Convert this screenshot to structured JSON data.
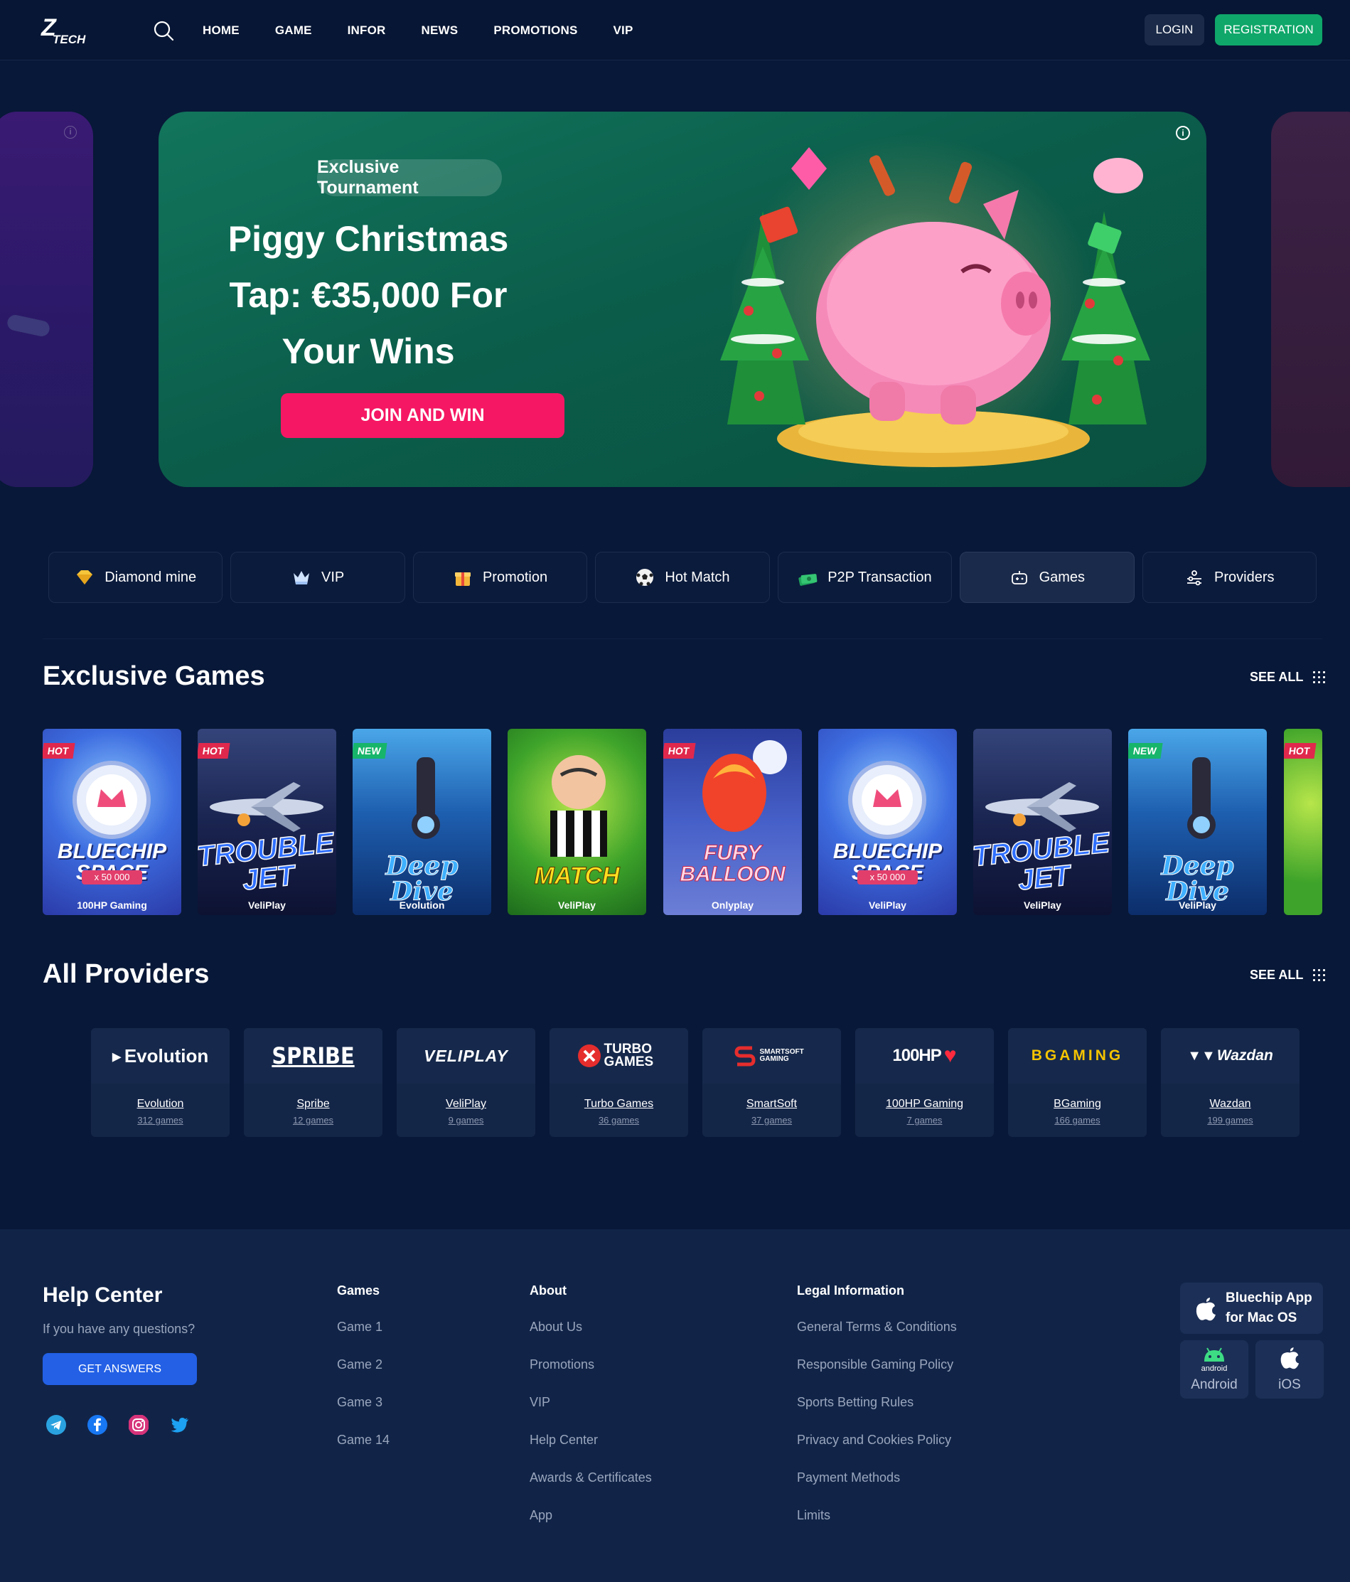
{
  "header": {
    "logo_mark": "Z",
    "logo_text": "TECH",
    "nav": [
      "HOME",
      "GAME",
      "INFOR",
      "NEWS",
      "PROMOTIONS",
      "VIP"
    ],
    "login_label": "LOGIN",
    "registration_label": "REGISTRATION"
  },
  "banner": {
    "badge": "Exclusive Tournament",
    "title": "Piggy Christmas Tap: €35,000 For Your Wins",
    "cta": "JOIN AND WIN",
    "info_glyph": "i"
  },
  "quick_links": [
    {
      "label": "Diamond mine",
      "icon": "diamond-icon"
    },
    {
      "label": "VIP",
      "icon": "crown-icon"
    },
    {
      "label": "Promotion",
      "icon": "gift-icon"
    },
    {
      "label": "Hot Match",
      "icon": "soccer-ball-icon"
    },
    {
      "label": "P2P Transaction",
      "icon": "money-icon"
    },
    {
      "label": "Games",
      "icon": "gamepad-icon",
      "selected": true
    },
    {
      "label": "Providers",
      "icon": "providers-icon"
    }
  ],
  "exclusive_games": {
    "title": "Exclusive Games",
    "see_all": "SEE ALL",
    "items": [
      {
        "name": "BLUECHIP SPACE",
        "sub": "x 50 000",
        "provider": "100HP Gaming",
        "tag": "HOT"
      },
      {
        "name": "TROUBLE JET",
        "provider": "VeliPlay",
        "tag": "HOT"
      },
      {
        "name": "Deep Dive",
        "provider": "Evolution",
        "tag": "NEW"
      },
      {
        "name": "MATCH",
        "provider": "VeliPlay",
        "tag": ""
      },
      {
        "name": "FURY BALLOON",
        "provider": "Onlyplay",
        "tag": "HOT"
      },
      {
        "name": "BLUECHIP SPACE",
        "sub": "x 50 000",
        "provider": "VeliPlay",
        "tag": ""
      },
      {
        "name": "TROUBLE JET",
        "provider": "VeliPlay",
        "tag": ""
      },
      {
        "name": "Deep Dive",
        "provider": "VeliPlay",
        "tag": "NEW"
      },
      {
        "name": "",
        "provider": "",
        "tag": "HOT"
      }
    ]
  },
  "all_providers": {
    "title": "All Providers",
    "see_all": "SEE ALL",
    "items": [
      {
        "logo": "Evolution",
        "name": "Evolution",
        "count": "312 games"
      },
      {
        "logo": "SPRIBE",
        "name": "Spribe",
        "count": "12 games"
      },
      {
        "logo": "VELIPLAY",
        "name": "VeliPlay",
        "count": "9 games"
      },
      {
        "logo": "TURBO GAMES",
        "name": "Turbo Games",
        "count": "36 games"
      },
      {
        "logo": "SMARTSOFT GAMING",
        "name": "SmartSoft",
        "count": "37 games"
      },
      {
        "logo": "100HP",
        "name": "100HP Gaming",
        "count": "7 games"
      },
      {
        "logo": "BGAMING",
        "name": "BGaming",
        "count": "166 games"
      },
      {
        "logo": "Wazdan",
        "name": "Wazdan",
        "count": "199 games"
      }
    ]
  },
  "footer": {
    "help_title": "Help Center",
    "help_question": "If you have any questions?",
    "help_button": "GET ANSWERS",
    "columns": [
      {
        "title": "Games",
        "links": [
          "Game 1",
          "Game 2",
          "Game 3",
          "Game 14"
        ]
      },
      {
        "title": "About",
        "links": [
          "About Us",
          "Promotions",
          "VIP",
          "Help Center",
          "Awards & Certificates",
          "App"
        ]
      },
      {
        "title": "Legal Information",
        "links": [
          "General Terms & Conditions",
          "Responsible Gaming Policy",
          "Sports Betting Rules",
          "Privacy and Cookies Policy",
          "Payment Methods",
          "Limits"
        ]
      }
    ],
    "app_mac_line1": "Bluechip App",
    "app_mac_line2": "for Mac OS",
    "app_android": "Android",
    "app_android_badge": "android",
    "app_ios": "iOS"
  },
  "colors": {
    "bg": "#081838",
    "accent_green": "#0fa76a",
    "cta_pink": "#f51763",
    "button_blue": "#2360e6"
  }
}
